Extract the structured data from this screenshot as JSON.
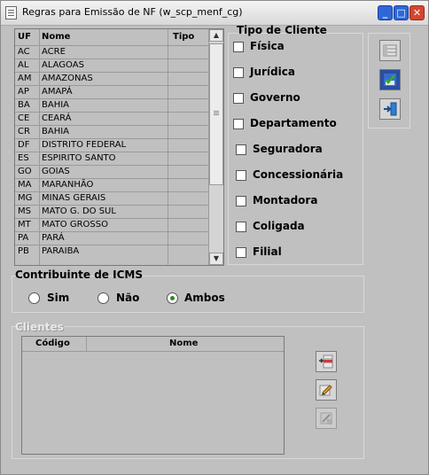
{
  "window": {
    "title": "Regras para Emissão de NF (w_scp_menf_cg)",
    "minimize": "_",
    "maximize": "□",
    "close": "✕"
  },
  "uf_table": {
    "columns": [
      "UF",
      "Nome",
      "Tipo"
    ],
    "rows": [
      {
        "uf": "AC",
        "nome": "ACRE"
      },
      {
        "uf": "AL",
        "nome": "ALAGOAS"
      },
      {
        "uf": "AM",
        "nome": "AMAZONAS"
      },
      {
        "uf": "AP",
        "nome": "AMAPÁ"
      },
      {
        "uf": "BA",
        "nome": "BAHIA"
      },
      {
        "uf": "CE",
        "nome": "CEARÁ"
      },
      {
        "uf": "CR",
        "nome": "BAHIA"
      },
      {
        "uf": "DF",
        "nome": "DISTRITO FEDERAL"
      },
      {
        "uf": "ES",
        "nome": "ESPIRITO SANTO"
      },
      {
        "uf": "GO",
        "nome": "GOIAS"
      },
      {
        "uf": "MA",
        "nome": "MARANHÃO"
      },
      {
        "uf": "MG",
        "nome": "MINAS GERAIS"
      },
      {
        "uf": "MS",
        "nome": "MATO G. DO SUL"
      },
      {
        "uf": "MT",
        "nome": "MATO GROSSO"
      },
      {
        "uf": "PA",
        "nome": "PARÁ"
      },
      {
        "uf": "PB",
        "nome": "PARAIBA"
      }
    ]
  },
  "tipo_cliente": {
    "title": "Tipo de Cliente",
    "options": [
      "Física",
      "Jurídica",
      "Governo",
      "Departamento",
      "Seguradora",
      "Concessionária",
      "Montadora",
      "Coligada",
      "Filial"
    ]
  },
  "icms": {
    "title": "Contribuinte de ICMS",
    "options": [
      "Sim",
      "Não",
      "Ambos"
    ],
    "selected": "Ambos"
  },
  "clientes": {
    "title": "Clientes",
    "columns": [
      "Código",
      "Nome"
    ]
  },
  "toolbar_icons": [
    "list-grid-icon",
    "check-save-icon",
    "exit-door-icon"
  ],
  "client_icons": [
    "insert-row-icon",
    "edit-pencil-icon",
    "delete-disabled-icon"
  ]
}
